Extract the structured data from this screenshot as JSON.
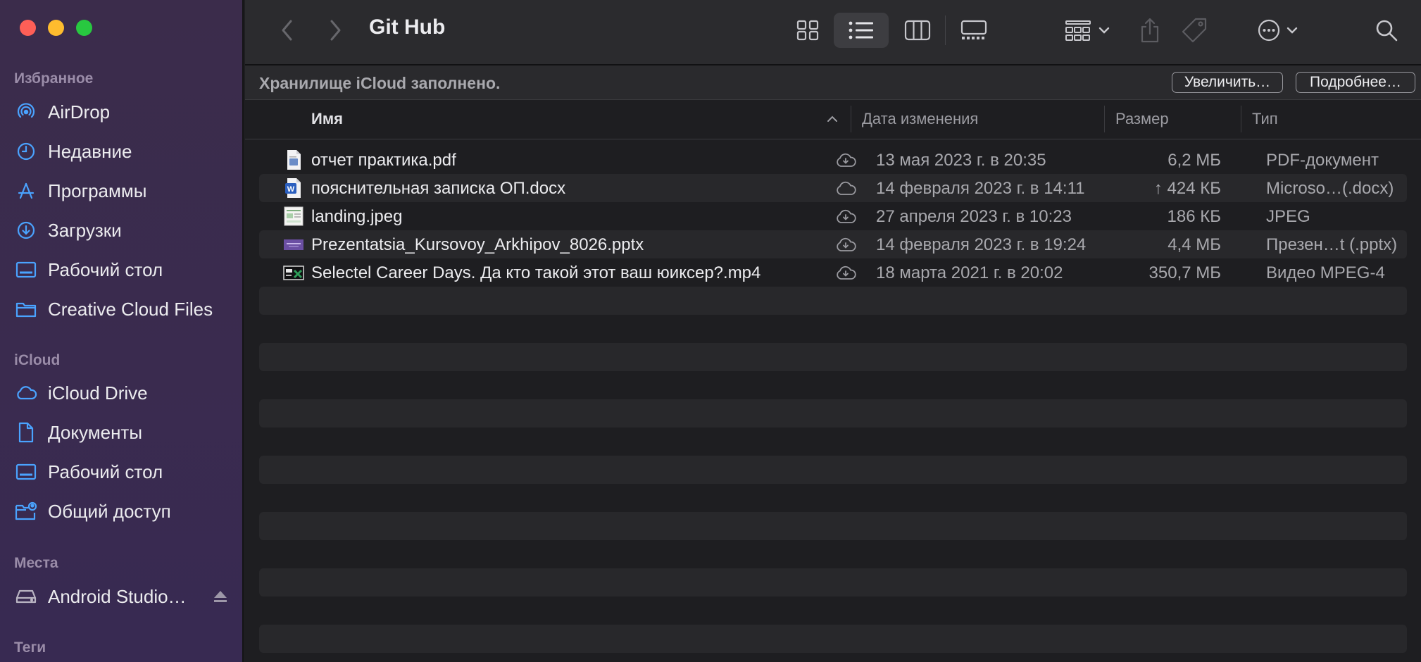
{
  "window": {
    "title": "Git Hub"
  },
  "sidebar": {
    "sections": [
      {
        "heading": "Избранное",
        "items": [
          {
            "label": "AirDrop",
            "icon": "airdrop-icon"
          },
          {
            "label": "Недавние",
            "icon": "clock-icon"
          },
          {
            "label": "Программы",
            "icon": "applications-icon"
          },
          {
            "label": "Загрузки",
            "icon": "download-icon"
          },
          {
            "label": "Рабочий стол",
            "icon": "desktop-icon"
          },
          {
            "label": "Creative Cloud Files",
            "icon": "folder-icon"
          }
        ]
      },
      {
        "heading": "iCloud",
        "items": [
          {
            "label": "iCloud Drive",
            "icon": "cloud-icon"
          },
          {
            "label": "Документы",
            "icon": "document-icon"
          },
          {
            "label": "Рабочий стол",
            "icon": "desktop-icon"
          },
          {
            "label": "Общий доступ",
            "icon": "shared-folder-icon"
          }
        ]
      },
      {
        "heading": "Места",
        "items": [
          {
            "label": "Android Studio…",
            "icon": "disk-icon"
          }
        ]
      },
      {
        "heading": "Теги",
        "items": []
      }
    ]
  },
  "banner": {
    "text": "Хранилище iCloud заполнено.",
    "upgrade_label": "Увеличить…",
    "details_label": "Подробнее…"
  },
  "columns": {
    "name": "Имя",
    "date": "Дата изменения",
    "size": "Размер",
    "kind": "Тип"
  },
  "files": [
    {
      "name": "отчет практика.pdf",
      "date": "13 мая 2023 г. в 20:35",
      "size": "6,2 МБ",
      "kind": "PDF-документ",
      "icon": "pdf-file-icon",
      "cloud": "cloud-download-icon"
    },
    {
      "name": "пояснительная записка ОП.docx",
      "date": "14 февраля 2023 г. в 14:11",
      "size": "↑ 424 КБ",
      "kind": "Microso…(.docx)",
      "icon": "word-file-icon",
      "cloud": "cloud-icon"
    },
    {
      "name": "landing.jpeg",
      "date": "27 апреля 2023 г. в 10:23",
      "size": "186 КБ",
      "kind": "JPEG",
      "icon": "image-file-icon",
      "cloud": "cloud-download-icon"
    },
    {
      "name": "Prezentatsia_Kursovoy_Arkhipov_8026.pptx",
      "date": "14 февраля 2023 г. в 19:24",
      "size": "4,4 МБ",
      "kind": "Презен…t (.pptx)",
      "icon": "pptx-file-icon",
      "cloud": "cloud-download-icon"
    },
    {
      "name": "Selectel Career Days. Да кто такой этот ваш юиксер?.mp4",
      "date": "18 марта 2021 г. в 20:02",
      "size": "350,7 МБ",
      "kind": "Видео MPEG-4",
      "icon": "video-file-icon",
      "cloud": "cloud-download-icon"
    }
  ],
  "colors": {
    "accent": "#4aa3ff",
    "sidebar_bg": "#3a2b4f",
    "window_bg": "#1e1e21"
  }
}
